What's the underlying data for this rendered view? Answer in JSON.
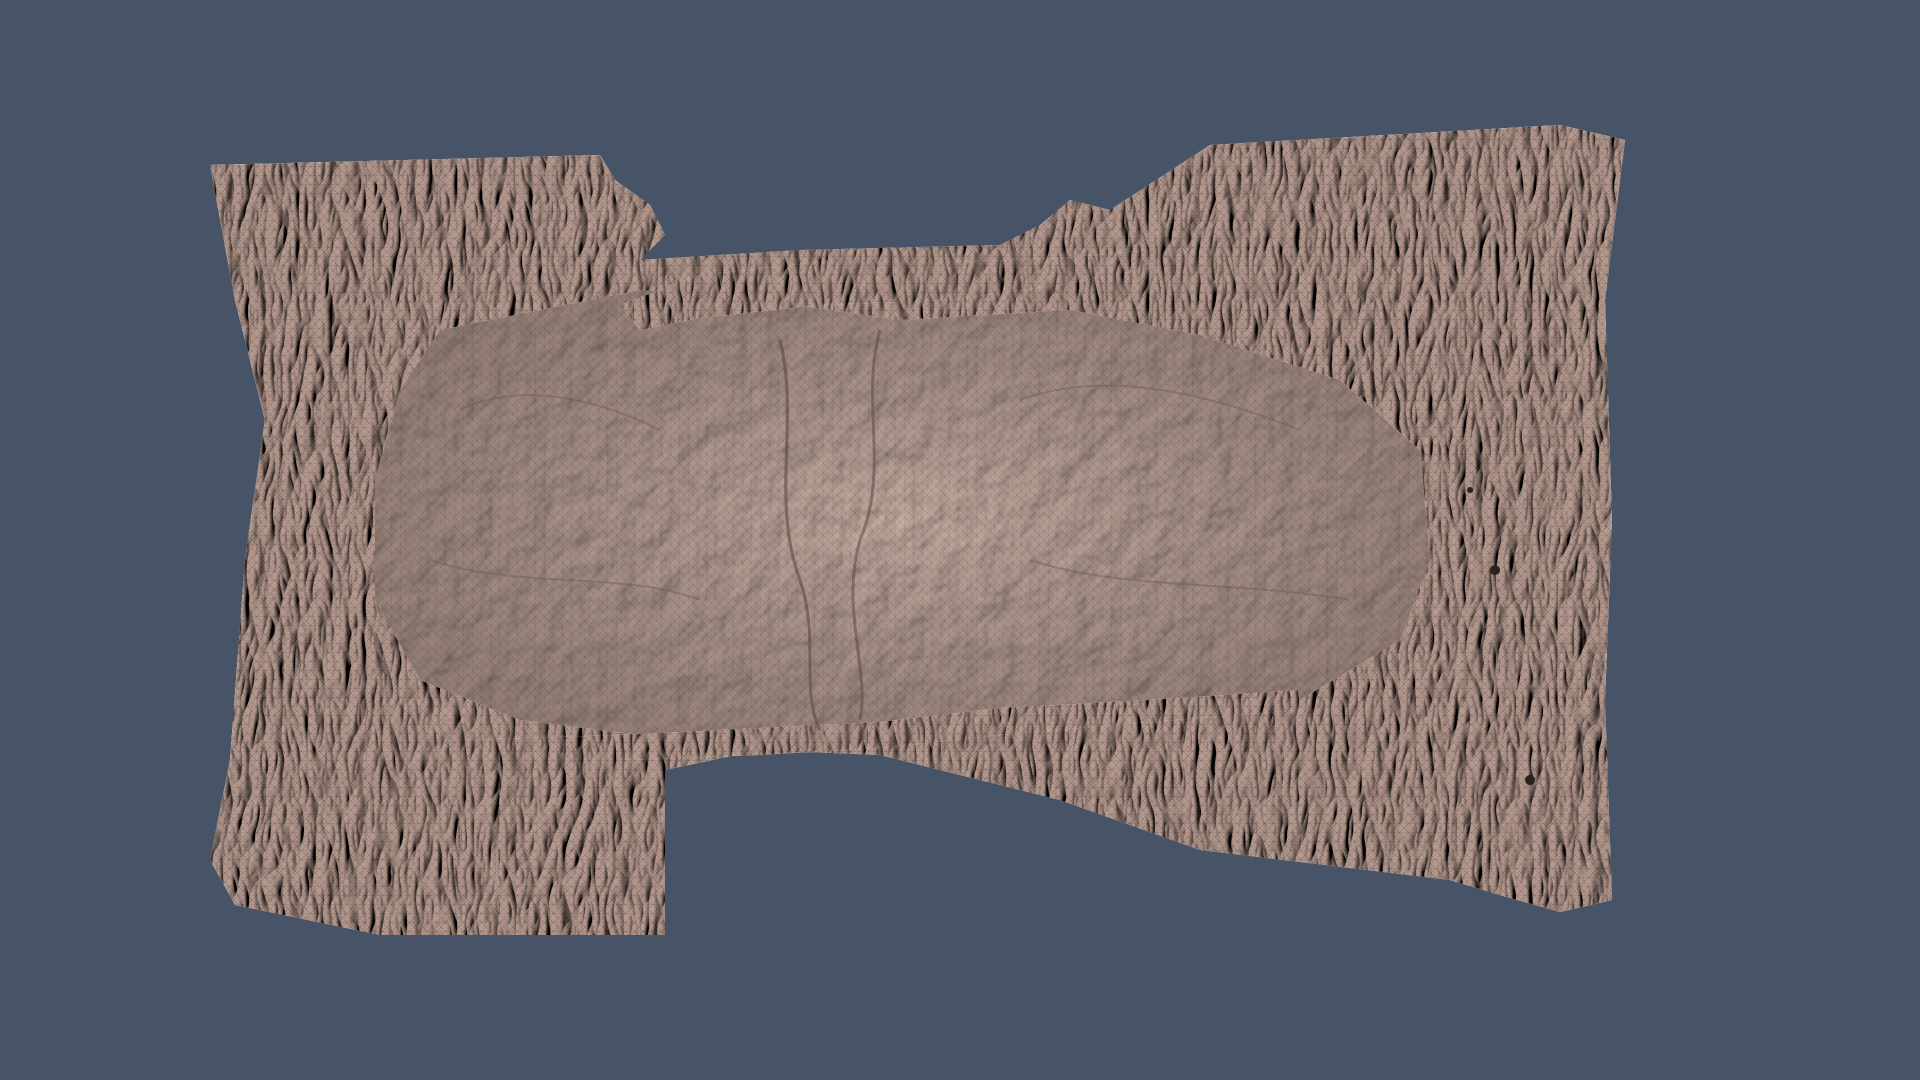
{
  "viewport": {
    "background_color": "#475366",
    "object": "wireframe-mesh-diaper",
    "mesh_color": "#b59a8f",
    "mesh_shadow_color": "#6e5a53",
    "mesh_highlight_color": "#d8c0b5",
    "wire_color": "#4a3a35"
  }
}
